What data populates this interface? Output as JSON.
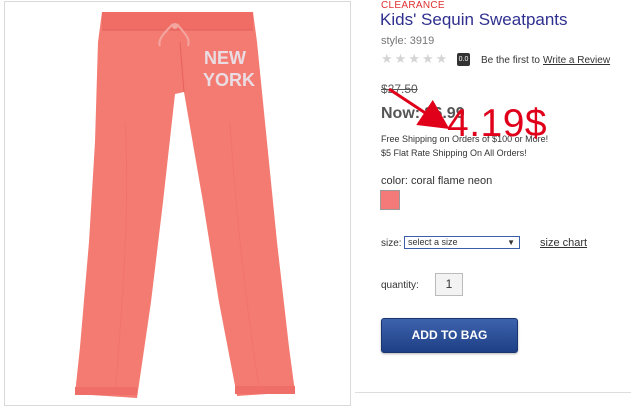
{
  "product": {
    "badge": "CLEARANCE",
    "title": "Kids' Sequin Sweatpants",
    "style": "style: 3919",
    "print_text": "NEW YORK",
    "rating_badge": "0.0",
    "review_prompt": "Be the first to",
    "review_link": "Write a Review",
    "rating": 0,
    "max_rating": 5,
    "original_price": "$27.50",
    "now_price": "Now: $6.99",
    "shipping_line1": "Free Shipping on Orders of $100 or More!",
    "shipping_line2": "$5 Flat Rate Shipping On All Orders!"
  },
  "annotation": {
    "price": "4.19$",
    "color": "#e0001a"
  },
  "options": {
    "color_label": "color: coral flame neon",
    "swatch_color": "#f47a7a",
    "size_label": "size:",
    "size_selected": "select a size",
    "size_chart_link": "size chart",
    "quantity_label": "quantity:",
    "quantity_value": "1"
  },
  "actions": {
    "add_to_bag": "ADD TO BAG"
  },
  "colors": {
    "pants": "#f47b72",
    "button": "#2d4f9a",
    "title": "#2f2f8f"
  }
}
